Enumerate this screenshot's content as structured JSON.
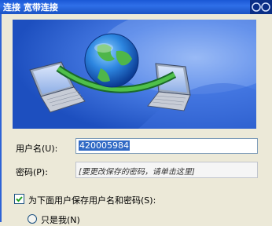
{
  "window": {
    "title": "连接 宽带连接"
  },
  "form": {
    "username_label": "用户名(U):",
    "username_value": "420005984",
    "password_label": "密码(P):",
    "password_placeholder": "[要更改保存的密码，请单击这里]",
    "save_checkbox_label": "为下面用户保存用户名和密码(S):",
    "save_checkbox_checked": true,
    "radio_me_only_label": "只是我(N)"
  },
  "icons": {
    "banner": "network-connection-globe-laptops",
    "window_controls": "window-controls-icon"
  },
  "colors": {
    "titlebar": "#1b58d6",
    "dialog_bg": "#ece9d8",
    "banner_bg": "#2a5fd0",
    "selection": "#316ac5"
  }
}
